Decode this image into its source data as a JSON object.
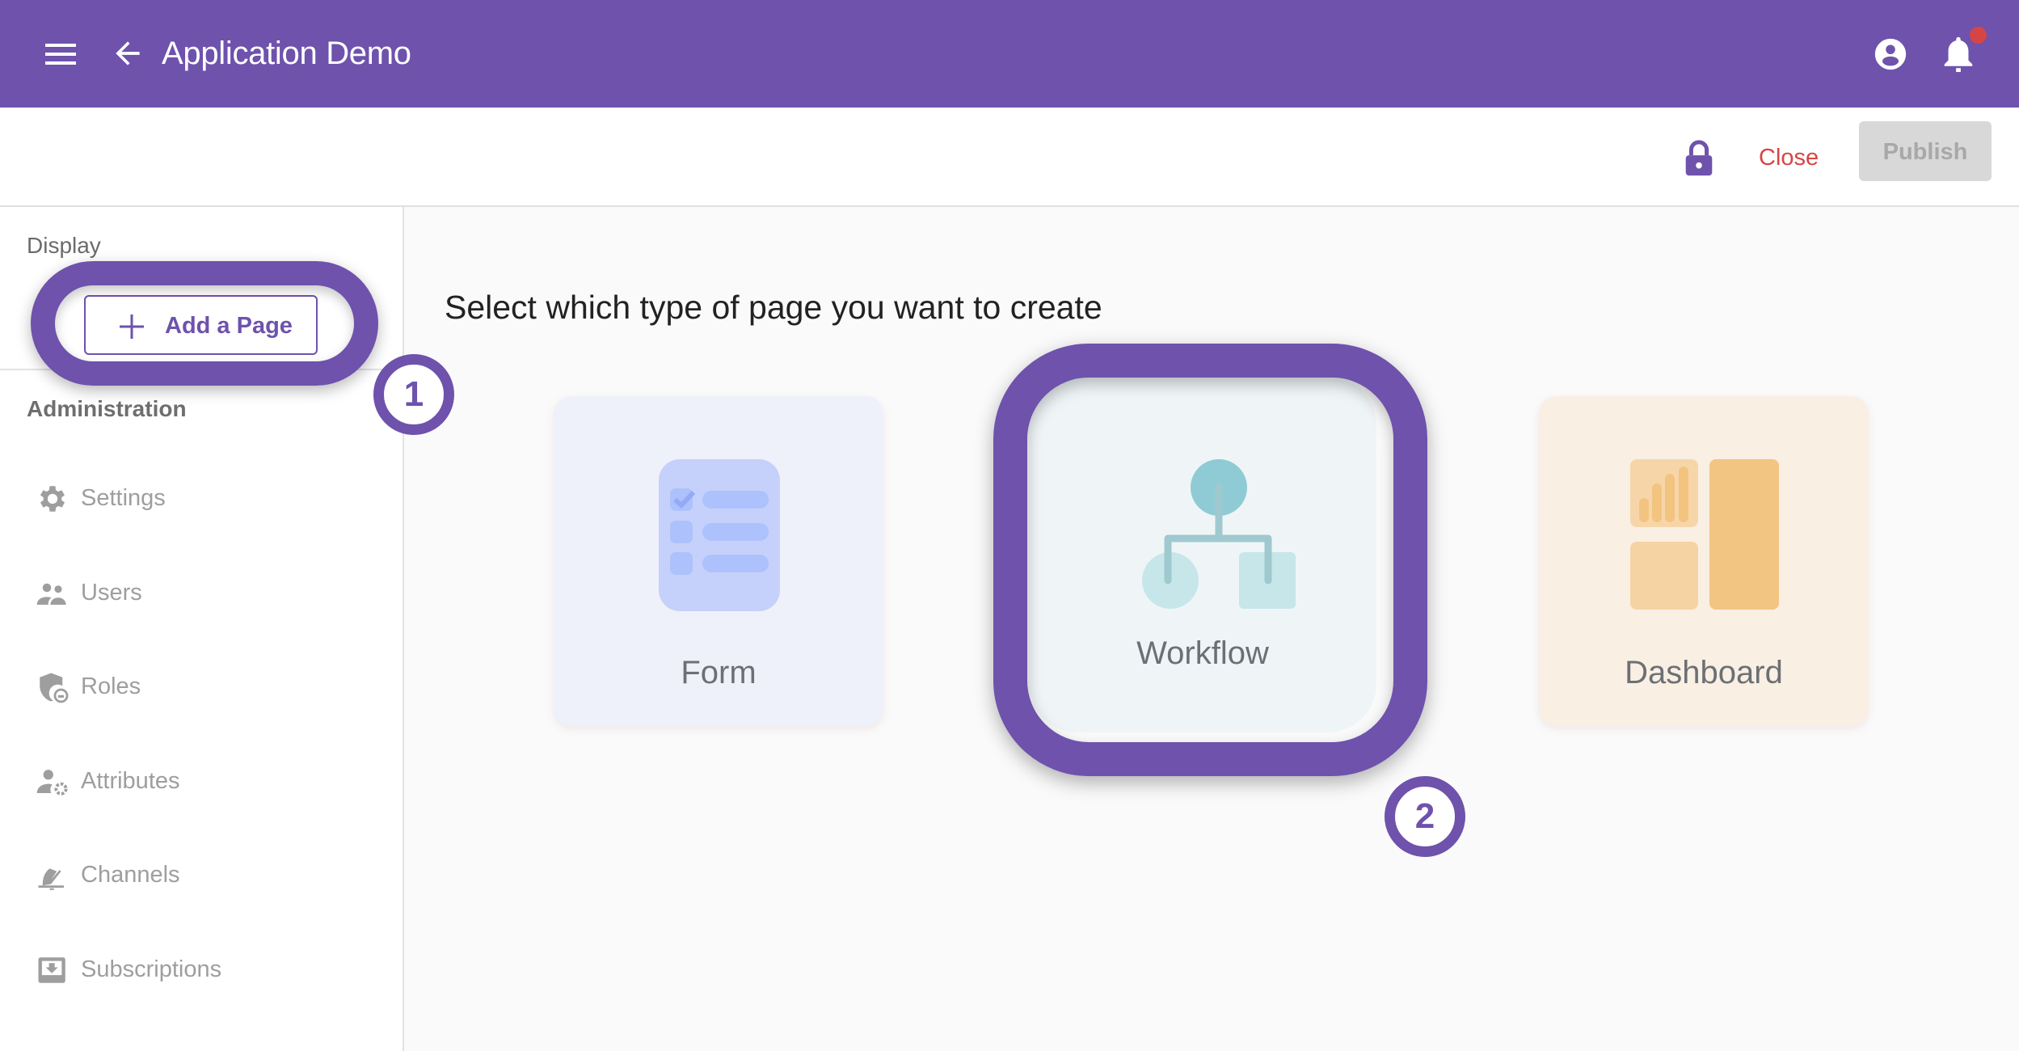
{
  "appbar": {
    "title": "Application Demo",
    "icons": {
      "menu": "hamburger-menu-icon",
      "back": "arrow-left-icon",
      "account": "account-circle-icon",
      "notifications": "bell-icon"
    },
    "notification_dot_color": "#d64545",
    "brand_color": "#6e52ac"
  },
  "toolbar": {
    "lock_icon": "lock-icon",
    "close_label": "Close",
    "publish_label": "Publish"
  },
  "sidebar": {
    "display_label": "Display",
    "add_page_label": "Add a Page",
    "administration_label": "Administration",
    "items": [
      {
        "label": "Settings",
        "icon": "gear-icon"
      },
      {
        "label": "Users",
        "icon": "users-icon"
      },
      {
        "label": "Roles",
        "icon": "shield-user-icon"
      },
      {
        "label": "Attributes",
        "icon": "user-gear-icon"
      },
      {
        "label": "Channels",
        "icon": "channel-broadcast-icon"
      },
      {
        "label": "Subscriptions",
        "icon": "inbox-download-icon"
      }
    ]
  },
  "main": {
    "title": "Select which type of page you want to create",
    "cards": [
      {
        "label": "Form",
        "icon": "form-checklist-icon"
      },
      {
        "label": "Workflow",
        "icon": "workflow-tree-icon"
      },
      {
        "label": "Dashboard",
        "icon": "dashboard-grid-icon"
      }
    ]
  },
  "annotations": {
    "step1": "1",
    "step2": "2"
  }
}
